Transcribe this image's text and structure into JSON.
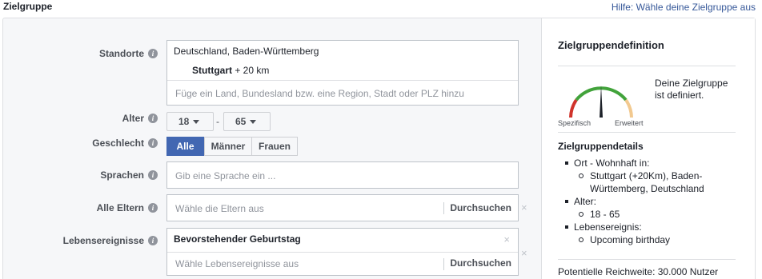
{
  "header": {
    "title": "Zielgruppe",
    "help_link": "Hilfe: Wähle deine Zielgruppe aus"
  },
  "form": {
    "locations": {
      "label": "Standorte",
      "region": "Deutschland, Baden-Württemberg",
      "city": "Stuttgart",
      "radius": "+ 20 km",
      "placeholder": "Füge ein Land, Bundesland bzw. eine Region, Stadt oder PLZ hinzu"
    },
    "age": {
      "label": "Alter",
      "min": "18",
      "separator": "-",
      "max": "65"
    },
    "gender": {
      "label": "Geschlecht",
      "options": [
        "Alle",
        "Männer",
        "Frauen"
      ],
      "selected": "Alle"
    },
    "languages": {
      "label": "Sprachen",
      "placeholder": "Gib eine Sprache ein ..."
    },
    "parents": {
      "label": "Alle Eltern",
      "placeholder": "Wähle die Eltern aus",
      "browse": "Durchsuchen",
      "clear": "×"
    },
    "life_events": {
      "label": "Lebensereignisse",
      "selected": "Bevorstehender Geburtstag",
      "placeholder": "Wähle Lebensereignisse aus",
      "browse": "Durchsuchen",
      "remove": "×",
      "clear": "×"
    },
    "info_glyph": "i"
  },
  "sidebar": {
    "title": "Zielgruppendefinition",
    "gauge": {
      "left_label": "Spezifisch",
      "right_label": "Erweitert",
      "colors": {
        "left": "#d0342c",
        "middle": "#42a33b",
        "right": "#f2c98f",
        "needle": "#1d2129"
      }
    },
    "definition_text": "Deine Zielgruppe ist definiert.",
    "details_title": "Zielgruppendetails",
    "details": [
      {
        "label": "Ort - Wohnhaft in:",
        "sub": [
          "Stuttgart (+20Km), Baden-Württemberg, Deutschland"
        ]
      },
      {
        "label": "Alter:",
        "sub": [
          "18 - 65"
        ]
      },
      {
        "label": "Lebensereignis:",
        "sub": [
          "Upcoming birthday"
        ]
      }
    ],
    "reach": "Potentielle Reichweite: 30.000 Nutzer"
  },
  "colors": {
    "accent": "#4267b2",
    "link": "#365899"
  }
}
